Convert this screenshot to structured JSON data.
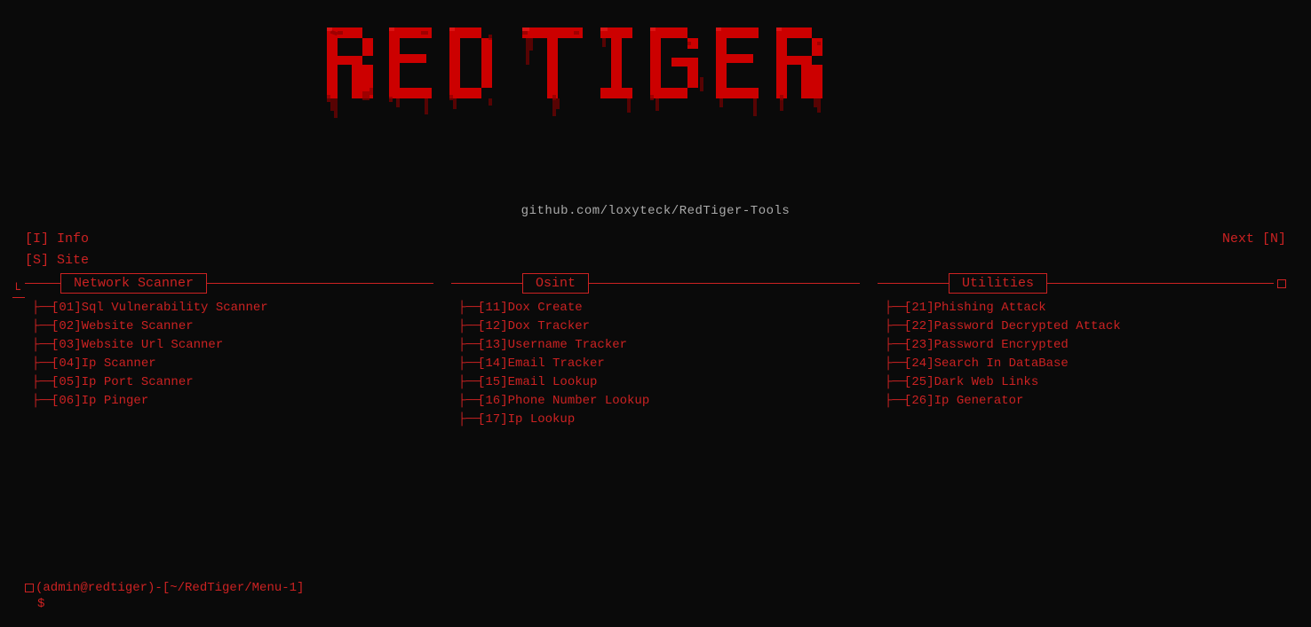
{
  "app": {
    "title": "RED TIGER",
    "github": "github.com/loxyteck/RedTiger-Tools"
  },
  "nav": {
    "info_label": "[I]  Info",
    "site_label": "[S]  Site",
    "next_label": "Next [N]"
  },
  "panels": [
    {
      "id": "network-scanner",
      "title": "Network Scanner",
      "items": [
        {
          "num": "[01]",
          "label": "Sql Vulnerability Scanner"
        },
        {
          "num": "[02]",
          "label": "Website Scanner"
        },
        {
          "num": "[03]",
          "label": "Website Url Scanner"
        },
        {
          "num": "[04]",
          "label": "Ip Scanner"
        },
        {
          "num": "[05]",
          "label": "Ip Port Scanner"
        },
        {
          "num": "[06]",
          "label": "Ip Pinger"
        }
      ]
    },
    {
      "id": "osint",
      "title": "Osint",
      "items": [
        {
          "num": "[11]",
          "label": "Dox Create"
        },
        {
          "num": "[12]",
          "label": "Dox Tracker"
        },
        {
          "num": "[13]",
          "label": "Username Tracker"
        },
        {
          "num": "[14]",
          "label": "Email Tracker"
        },
        {
          "num": "[15]",
          "label": "Email Lookup"
        },
        {
          "num": "[16]",
          "label": "Phone Number Lookup"
        },
        {
          "num": "[17]",
          "label": "Ip Lookup"
        }
      ]
    },
    {
      "id": "utilities",
      "title": "Utilities",
      "items": [
        {
          "num": "[21]",
          "label": "Phishing Attack"
        },
        {
          "num": "[22]",
          "label": "Password Decrypted Attack"
        },
        {
          "num": "[23]",
          "label": "Password Encrypted"
        },
        {
          "num": "[24]",
          "label": "Search In DataBase"
        },
        {
          "num": "[25]",
          "label": "Dark Web Links"
        },
        {
          "num": "[26]",
          "label": "Ip Generator"
        }
      ]
    }
  ],
  "terminal": {
    "prompt": "(admin@redtiger)-[~/RedTiger/Menu-1]",
    "dollar": "$"
  }
}
